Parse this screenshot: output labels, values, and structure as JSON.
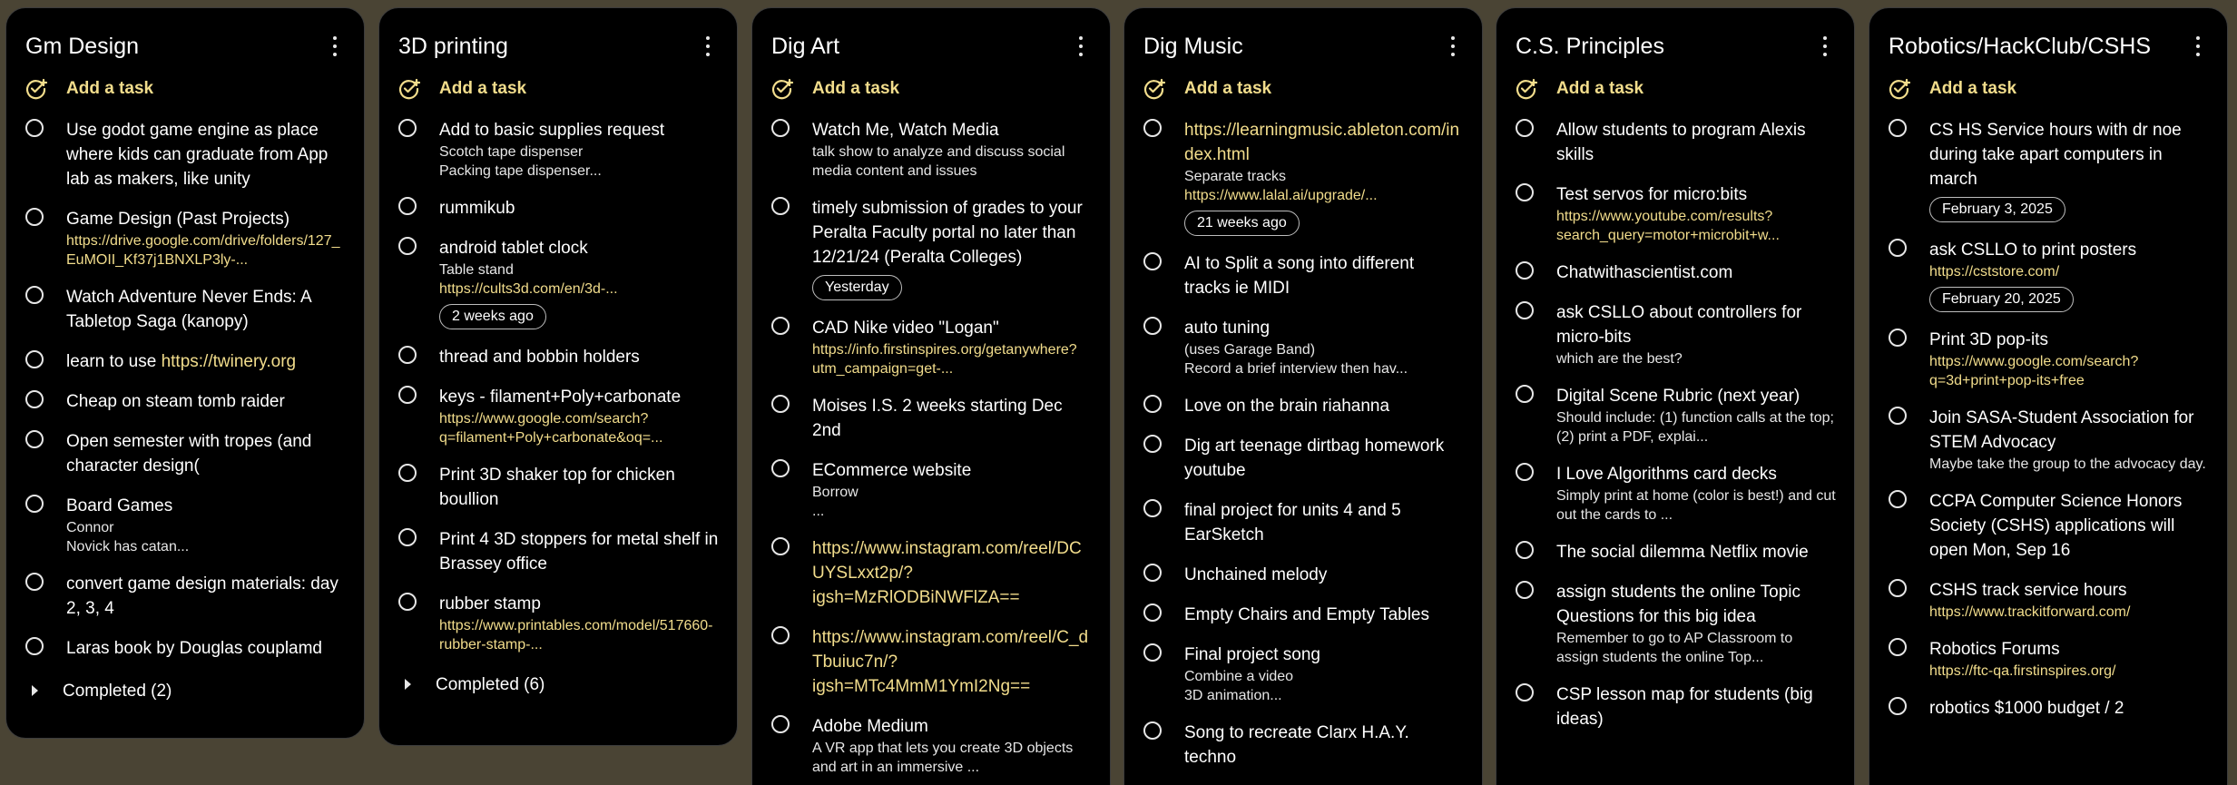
{
  "add_task_label": "Add a task",
  "colors": {
    "background": "#4a4434",
    "panel": "#000000",
    "accent": "#f2dd8c",
    "text": "#ffffff"
  },
  "icons": {
    "add": "add-task-icon",
    "menu": "more-vert-icon",
    "checkbox": "circle-checkbox-icon",
    "expand": "caret-right-icon"
  },
  "columns": [
    {
      "title": "Gm Design",
      "tasks": [
        {
          "title": "Use godot game engine as place where kids can graduate from App lab as makers, like unity"
        },
        {
          "title": "Game Design (Past Projects)",
          "notes": "https://drive.google.com/drive/folders/127_EuMOII_Kf37j1BNXLP3ly-..."
        },
        {
          "title": "Watch Adventure Never Ends: A Tabletop Saga (kanopy)"
        },
        {
          "title": "learn to use ",
          "title_link": "https://twinery.org"
        },
        {
          "title": "Cheap on steam tomb raider"
        },
        {
          "title": "Open semester with tropes (and character design("
        },
        {
          "title": "Board Games",
          "notes": "Connor\nNovick has catan..."
        },
        {
          "title": "convert game design materials: day 2, 3, 4"
        },
        {
          "title": "Laras book by Douglas couplamd"
        }
      ],
      "completed_label": "Completed (2)"
    },
    {
      "title": "3D printing",
      "tasks": [
        {
          "title": "Add to basic supplies request",
          "notes": "Scotch tape dispenser\nPacking tape dispenser..."
        },
        {
          "title": "rummikub"
        },
        {
          "title": "android tablet clock",
          "notes": "Table stand",
          "notes_link": "https://cults3d.com/en/3d-...",
          "chip": "2 weeks ago"
        },
        {
          "title": "thread and bobbin holders"
        },
        {
          "title": "keys - filament+Poly+carbonate",
          "notes": "https://www.google.com/search?q=filament+Poly+carbonate&oq=..."
        },
        {
          "title": "Print 3D shaker top for chicken boullion"
        },
        {
          "title": "Print 4 3D stoppers for metal shelf in Brassey office"
        },
        {
          "title": "rubber stamp",
          "notes": "https://www.printables.com/model/517660-rubber-stamp-..."
        }
      ],
      "completed_label": "Completed (6)"
    },
    {
      "title": "Dig Art",
      "tasks": [
        {
          "title": "Watch Me, Watch Media",
          "notes": "talk show to analyze and discuss social media content and issues"
        },
        {
          "title": "timely submission of grades to your Peralta Faculty portal no later than 12/21/24 (Peralta Colleges)",
          "chip": "Yesterday"
        },
        {
          "title": "CAD Nike video \"Logan\"",
          "notes": "https://info.firstinspires.org/getanywhere?utm_campaign=get-..."
        },
        {
          "title": "Moises I.S. 2 weeks starting Dec 2nd"
        },
        {
          "title": "ECommerce website",
          "notes": "Borrow\n..."
        },
        {
          "title": "https://www.instagram.com/reel/DCUYSLxxt2p/?igsh=MzRlODBiNWFlZA=="
        },
        {
          "title": "https://www.instagram.com/reel/C_dTbuiuc7n/?igsh=MTc4MmM1YmI2Ng=="
        },
        {
          "title": "Adobe Medium",
          "notes": "A VR app that lets you create 3D objects and art in an immersive ..."
        }
      ]
    },
    {
      "title": "Dig Music",
      "tasks": [
        {
          "title": "https://learningmusic.ableton.com/index.html",
          "notes": "Separate tracks",
          "notes_link": "https://www.lalal.ai/upgrade/...",
          "chip": "21 weeks ago"
        },
        {
          "title": "AI to Split a song into different tracks ie MIDI"
        },
        {
          "title": "auto tuning",
          "notes": "(uses Garage Band)\nRecord a brief interview then hav..."
        },
        {
          "title": "Love on the brain riahanna"
        },
        {
          "title": "Dig art teenage dirtbag homework youtube"
        },
        {
          "title": "final project for units 4 and 5 EarSketch"
        },
        {
          "title": "Unchained melody"
        },
        {
          "title": "Empty Chairs and Empty Tables"
        },
        {
          "title": "Final project song",
          "notes": "Combine a video\n3D animation..."
        },
        {
          "title": "Song to recreate Clarx H.A.Y. techno"
        }
      ]
    },
    {
      "title": "C.S. Principles",
      "tasks": [
        {
          "title": "Allow students to program Alexis skills"
        },
        {
          "title": "Test servos for micro:bits",
          "notes": "https://www.youtube.com/results?search_query=motor+microbit+w..."
        },
        {
          "title": "Chatwithascientist.com"
        },
        {
          "title": "ask CSLLO about controllers for micro-bits",
          "notes": "which are the best?"
        },
        {
          "title": "Digital Scene Rubric (next year)",
          "notes": "Should include: (1) function calls at the top; (2) print a PDF, explai..."
        },
        {
          "title": "I Love Algorithms card decks",
          "notes": "Simply print at home (color is best!) and cut out the cards to ..."
        },
        {
          "title": "The social dilemma Netflix movie"
        },
        {
          "title": "assign students the online Topic Questions for this big idea",
          "notes": "Remember to go to AP Classroom to assign students the online Top..."
        },
        {
          "title": "CSP lesson map for students (big ideas)"
        }
      ]
    },
    {
      "title": "Robotics/HackClub/CSHS",
      "tasks": [
        {
          "title": "CS HS Service hours with dr noe during take apart computers in march",
          "chip": "February 3, 2025"
        },
        {
          "title": "ask CSLLO to print posters",
          "notes": "https://cststore.com/",
          "chip": "February 20, 2025"
        },
        {
          "title": "Print 3D pop-its",
          "notes": "https://www.google.com/search?q=3d+print+pop-its+free"
        },
        {
          "title": "Join SASA-Student Association for STEM Advocacy",
          "notes": "Maybe take the group to the advocacy day."
        },
        {
          "title": "CCPA Computer Science Honors Society (CSHS) applications will open Mon, Sep 16"
        },
        {
          "title": "CSHS track service hours",
          "notes": "https://www.trackitforward.com/"
        },
        {
          "title": "Robotics Forums",
          "notes": "https://ftc-qa.firstinspires.org/"
        },
        {
          "title": "robotics $1000 budget / 2"
        }
      ]
    }
  ]
}
